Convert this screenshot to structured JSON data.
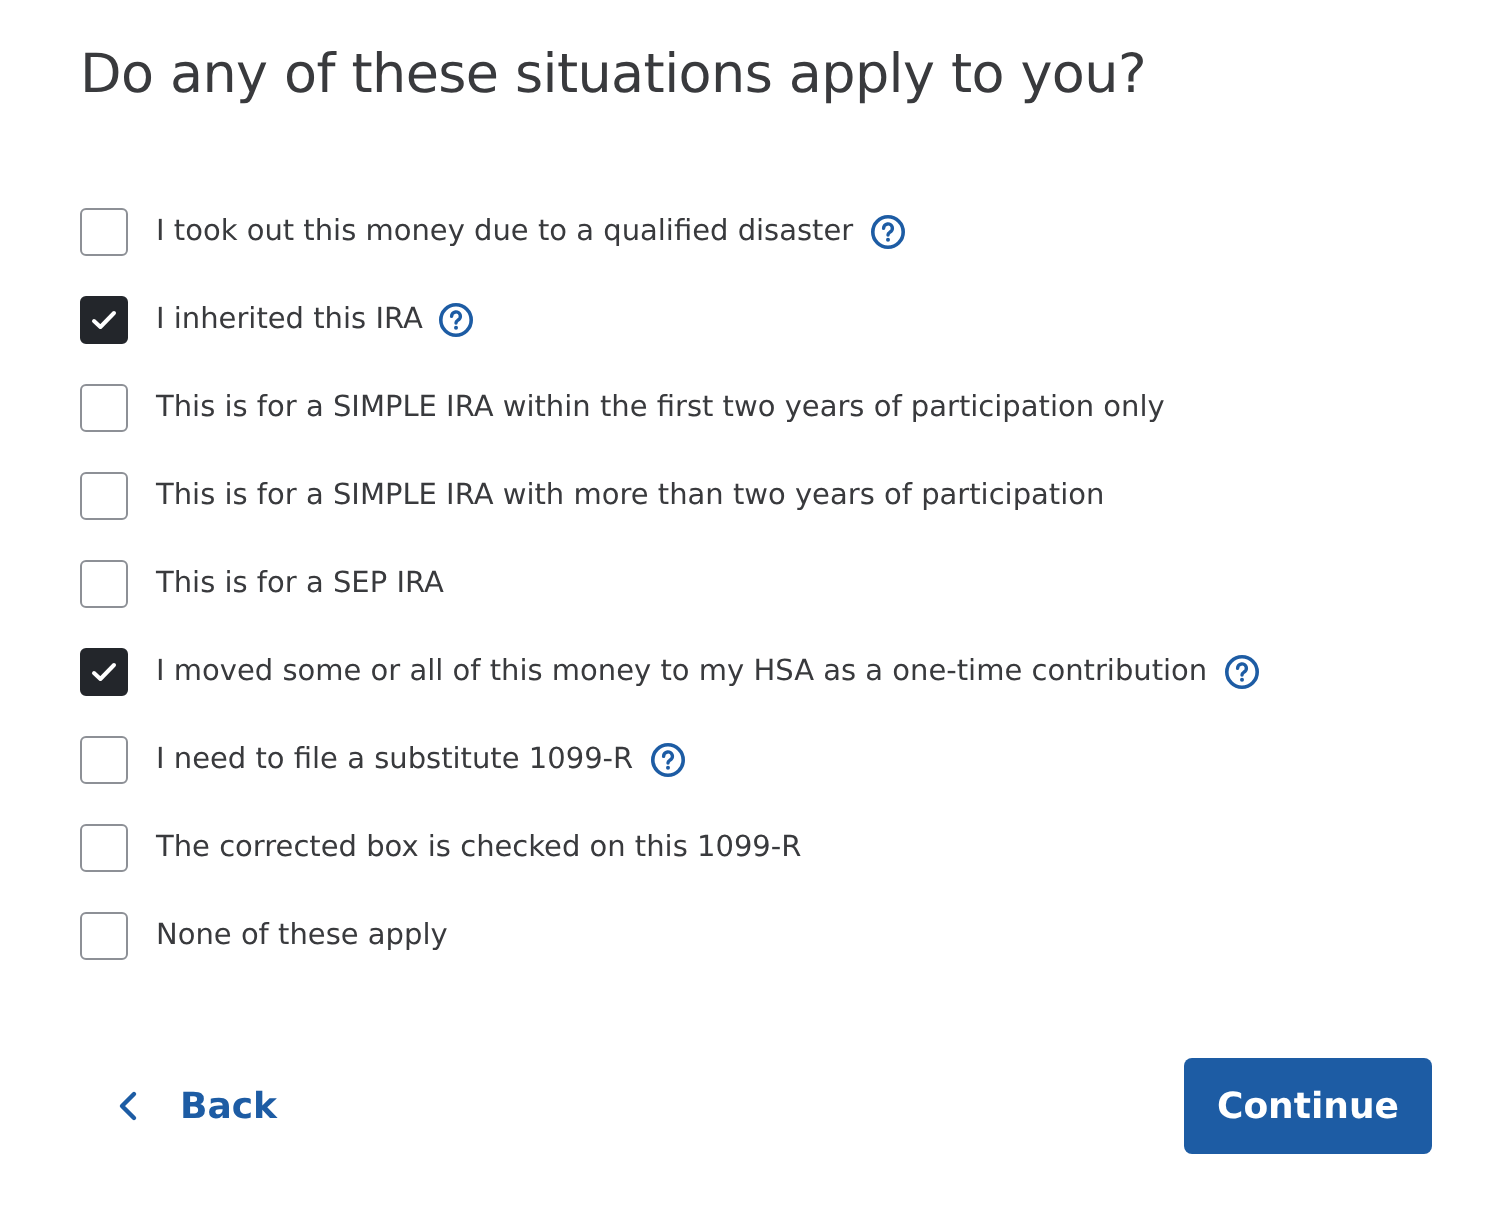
{
  "title": "Do any of these situations apply to you?",
  "options": [
    {
      "label": "I took out this money due to a qualified disaster",
      "checked": false,
      "help": true
    },
    {
      "label": "I inherited this IRA",
      "checked": true,
      "help": true
    },
    {
      "label": "This is for a SIMPLE IRA within the first two years of participation only",
      "checked": false,
      "help": false
    },
    {
      "label": "This is for a SIMPLE IRA with more than two years of participation",
      "checked": false,
      "help": false
    },
    {
      "label": "This is for a SEP IRA",
      "checked": false,
      "help": false
    },
    {
      "label": "I moved some or all of this money to my HSA as a one-time contribution",
      "checked": true,
      "help": true
    },
    {
      "label": "I need to file a substitute 1099-R",
      "checked": false,
      "help": true
    },
    {
      "label": "The corrected box is checked on this 1099-R",
      "checked": false,
      "help": false
    },
    {
      "label": "None of these apply",
      "checked": false,
      "help": false
    }
  ],
  "back": "Back",
  "continue": "Continue"
}
